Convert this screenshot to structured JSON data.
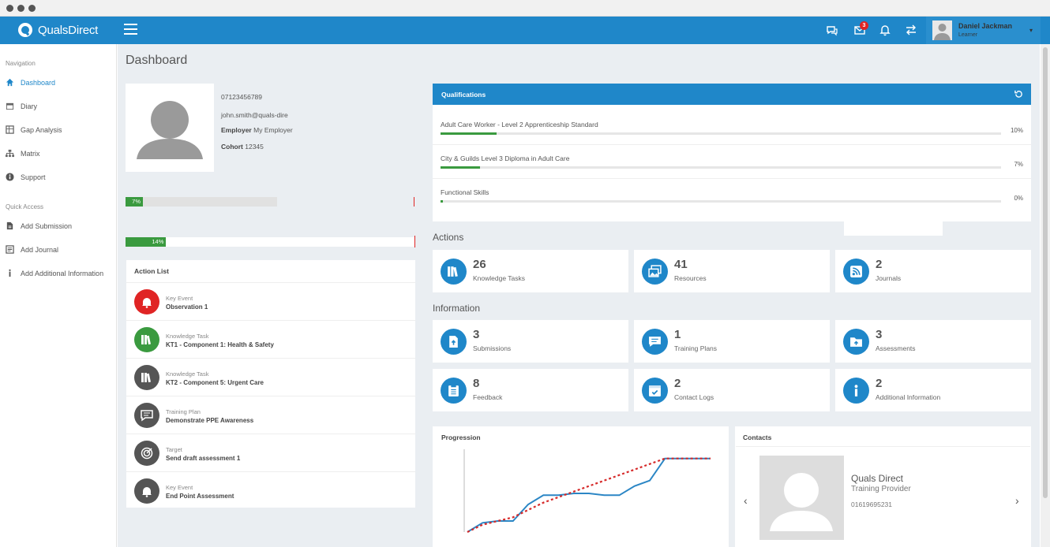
{
  "app": {
    "brand": "QualsDirect",
    "page_title": "Dashboard"
  },
  "header": {
    "notification_count": "3"
  },
  "user": {
    "name": "Daniel Jackman",
    "role": "Learner"
  },
  "sidebar": {
    "nav_heading": "Navigation",
    "nav_items": [
      {
        "label": "Dashboard",
        "icon": "home-icon"
      },
      {
        "label": "Diary",
        "icon": "calendar-icon"
      },
      {
        "label": "Gap Analysis",
        "icon": "grid-icon"
      },
      {
        "label": "Matrix",
        "icon": "sitemap-icon"
      },
      {
        "label": "Support",
        "icon": "info-icon"
      }
    ],
    "quick_heading": "Quick Access",
    "quick_items": [
      {
        "label": "Add Submission",
        "icon": "file-icon"
      },
      {
        "label": "Add Journal",
        "icon": "journal-icon"
      },
      {
        "label": "Add Additional Information",
        "icon": "info-icon"
      }
    ]
  },
  "profile": {
    "phone": "07123456789",
    "email": "john.smith@quals-dire",
    "employer_label": "Employer",
    "employer_value": "My Employer",
    "cohort_label": "Cohort",
    "cohort_value": "12345",
    "progress_1": {
      "label": "7%",
      "value": 0.07
    },
    "progress_2": {
      "label": "14%",
      "value": 0.14
    }
  },
  "action_list": {
    "title": "Action List",
    "items": [
      {
        "type": "Key Event",
        "title": "Observation 1",
        "color": "#e02424"
      },
      {
        "type": "Knowledge Task",
        "title": "KT1 - Component 1: Health & Safety",
        "color": "#3a9a3f"
      },
      {
        "type": "Knowledge Task",
        "title": "KT2 - Component 5: Urgent Care",
        "color": "#555555"
      },
      {
        "type": "Training Plan",
        "title": "Demonstrate PPE Awareness",
        "color": "#555555"
      },
      {
        "type": "Target",
        "title": "Send draft assessment 1",
        "color": "#555555"
      },
      {
        "type": "Key Event",
        "title": "End Point Assessment",
        "color": "#555555"
      }
    ]
  },
  "qualifications": {
    "title": "Qualifications",
    "items": [
      {
        "name": "Adult Care Worker - Level 2 Apprenticeship Standard",
        "percent": "10%",
        "value": 0.1
      },
      {
        "name": "City & Guilds Level 3 Diploma in Adult Care",
        "percent": "7%",
        "value": 0.07
      },
      {
        "name": "Functional Skills",
        "percent": "0%",
        "value": 0.0
      }
    ]
  },
  "actions": {
    "title": "Actions",
    "tiles": [
      {
        "count": "26",
        "label": "Knowledge Tasks",
        "icon": "books-icon"
      },
      {
        "count": "41",
        "label": "Resources",
        "icon": "images-icon"
      },
      {
        "count": "2",
        "label": "Journals",
        "icon": "rss-icon"
      }
    ]
  },
  "information": {
    "title": "Information",
    "tiles": [
      {
        "count": "3",
        "label": "Submissions",
        "icon": "upload-file-icon"
      },
      {
        "count": "1",
        "label": "Training Plans",
        "icon": "comment-icon"
      },
      {
        "count": "3",
        "label": "Assessments",
        "icon": "folder-icon"
      },
      {
        "count": "8",
        "label": "Feedback",
        "icon": "clipboard-icon"
      },
      {
        "count": "2",
        "label": "Contact Logs",
        "icon": "calendar-check-icon"
      },
      {
        "count": "2",
        "label": "Additional Information",
        "icon": "info-icon"
      }
    ]
  },
  "progression": {
    "title": "Progression",
    "chart_data": {
      "type": "line",
      "series": [
        {
          "values": [
            0,
            5,
            6,
            6,
            15,
            20,
            20,
            21,
            21,
            20,
            20,
            25,
            28,
            40,
            40,
            40,
            40
          ],
          "color": "#2b86c5"
        },
        {
          "values": [
            0,
            4,
            6,
            8,
            12,
            16,
            19,
            22,
            25,
            28,
            31,
            34,
            37,
            40,
            40,
            40,
            40
          ],
          "color": "#d62a2a"
        }
      ],
      "ylim": [
        0,
        45
      ]
    }
  },
  "contacts": {
    "title": "Contacts",
    "name": "Quals Direct",
    "role": "Training Provider",
    "phone": "01619695231"
  },
  "colors": {
    "brand": "#1f87c9",
    "success": "#3a9a3f",
    "danger": "#e02424"
  }
}
